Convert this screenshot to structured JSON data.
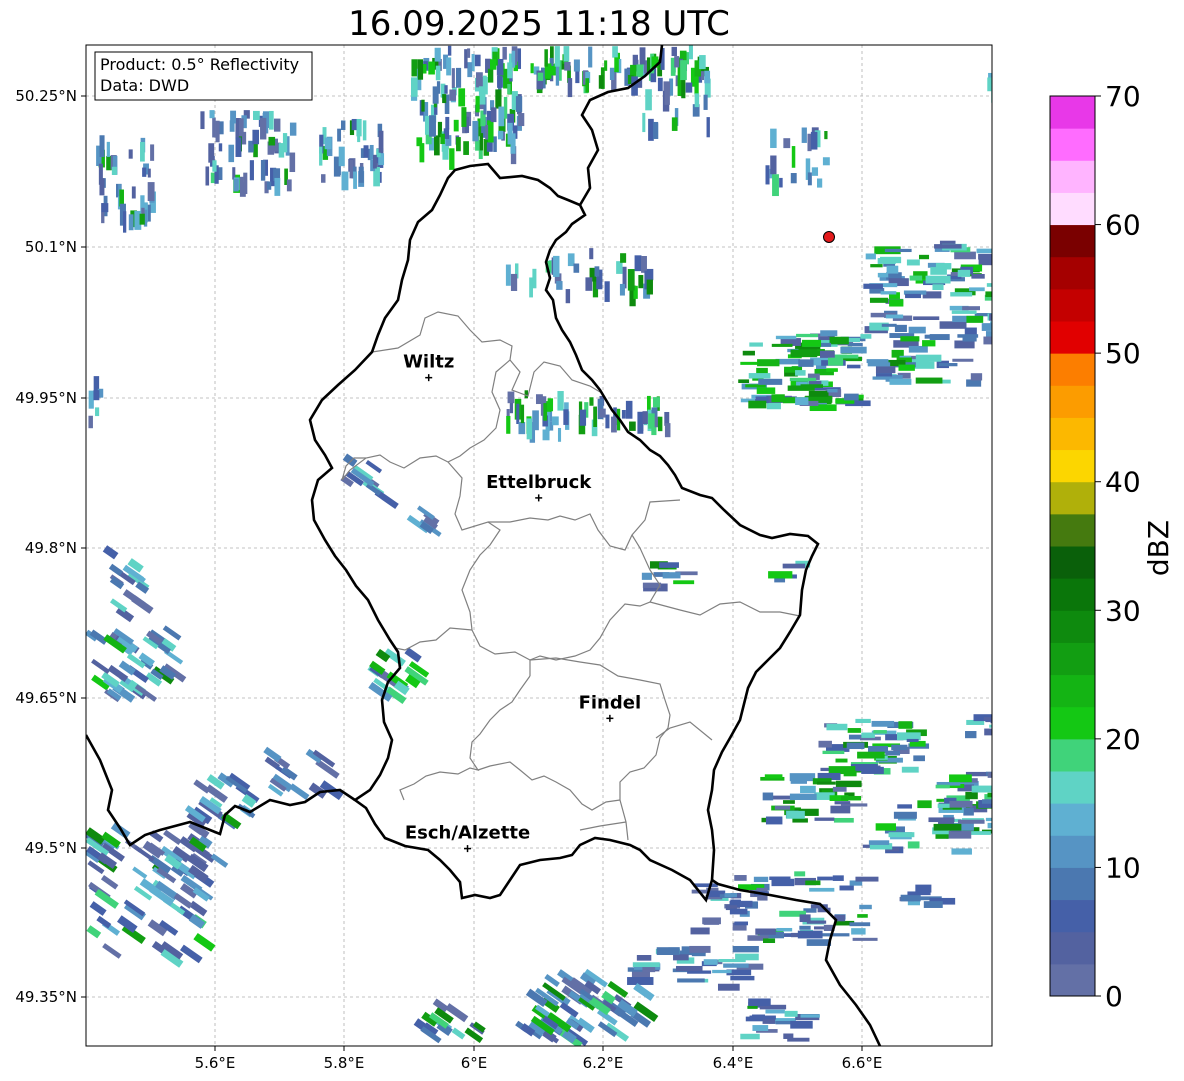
{
  "title": "16.09.2025 11:18 UTC",
  "info": {
    "product": "Product: 0.5° Reflectivity",
    "data": "Data: DWD"
  },
  "axes": {
    "lon_ticks": [
      "5.6°E",
      "5.8°E",
      "6°E",
      "6.2°E",
      "6.4°E",
      "6.6°E"
    ],
    "lat_ticks": [
      "50.25°N",
      "50.1°N",
      "49.95°N",
      "49.8°N",
      "49.65°N",
      "49.5°N",
      "49.35°N"
    ]
  },
  "cities": [
    {
      "name": "Wiltz",
      "lon": 5.93,
      "lat": 49.97
    },
    {
      "name": "Ettelbruck",
      "lon": 6.1,
      "lat": 49.85
    },
    {
      "name": "Findel",
      "lon": 6.21,
      "lat": 49.63
    },
    {
      "name": "Esch/Alzette",
      "lon": 5.99,
      "lat": 49.5
    }
  ],
  "radar_site": {
    "lon": 6.55,
    "lat": 50.11,
    "color": "#e31a1c"
  },
  "colorbar": {
    "title": "dBZ",
    "tick_labels": [
      "0",
      "10",
      "20",
      "30",
      "40",
      "50",
      "60",
      "70"
    ],
    "colors": [
      "#6370a6",
      "#5362a0",
      "#4560a8",
      "#4b78b0",
      "#5694c4",
      "#5fb0d2",
      "#5fd3c5",
      "#40d37a",
      "#14c814",
      "#14b414",
      "#129e12",
      "#0e8a0e",
      "#0a760a",
      "#0a600a",
      "#457a0f",
      "#b0b00a",
      "#fcd600",
      "#fcb800",
      "#fc9c00",
      "#fc7e00",
      "#e10000",
      "#c40000",
      "#a50000",
      "#7a0000",
      "#ffdcff",
      "#ffb4ff",
      "#ff6cff",
      "#e838e8"
    ]
  },
  "colors": {
    "border": "#000000",
    "canton_border": "#808080",
    "grid": "#b0b0b0"
  }
}
